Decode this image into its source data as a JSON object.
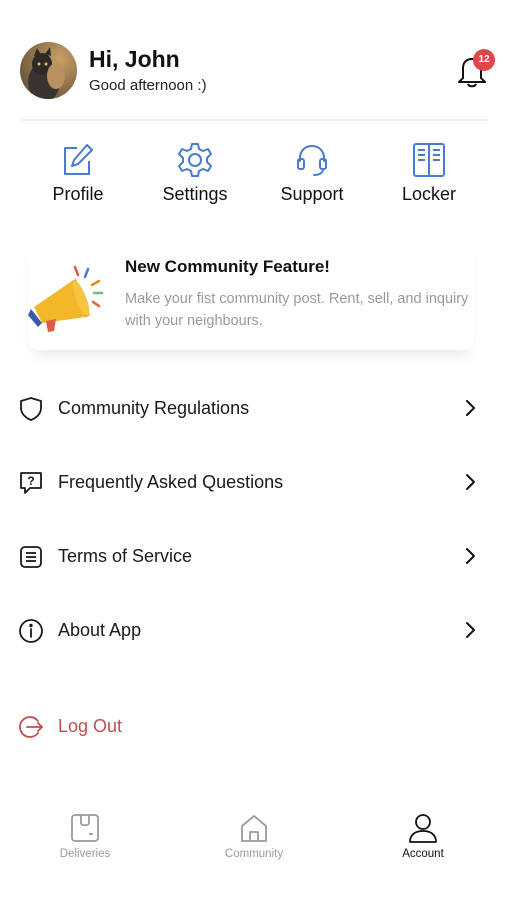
{
  "header": {
    "greeting": "Hi, John",
    "subtitle": "Good afternoon :)",
    "notification_count": "12"
  },
  "quick_actions": [
    {
      "label": "Profile",
      "icon": "edit-icon"
    },
    {
      "label": "Settings",
      "icon": "gear-icon"
    },
    {
      "label": "Support",
      "icon": "headset-icon"
    },
    {
      "label": "Locker",
      "icon": "locker-icon"
    }
  ],
  "banner": {
    "title": "New Community Feature!",
    "text": "Make your fist community post. Rent, sell, and inquiry with your neighbours.",
    "icon": "megaphone-icon"
  },
  "menu": [
    {
      "label": "Community Regulations",
      "icon": "shield-icon"
    },
    {
      "label": "Frequently Asked Questions",
      "icon": "question-bubble-icon"
    },
    {
      "label": "Terms of Service",
      "icon": "document-list-icon"
    },
    {
      "label": "About App",
      "icon": "info-icon"
    }
  ],
  "logout": {
    "label": "Log Out",
    "icon": "logout-icon"
  },
  "tabs": [
    {
      "label": "Deliveries",
      "icon": "package-icon",
      "active": false
    },
    {
      "label": "Community",
      "icon": "home-icon",
      "active": false
    },
    {
      "label": "Account",
      "icon": "user-icon",
      "active": true
    }
  ],
  "colors": {
    "accent_blue": "#4a7bd0",
    "badge_red": "#e0474c",
    "logout_red": "#c0504d",
    "muted_text": "#9a9a9a"
  }
}
